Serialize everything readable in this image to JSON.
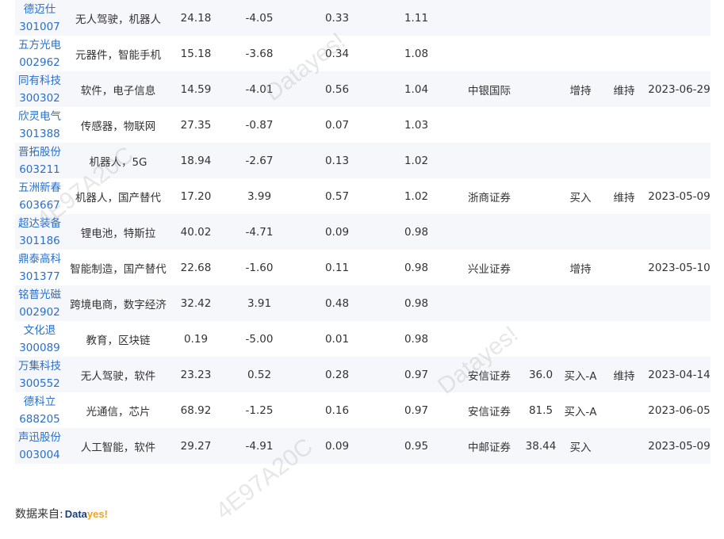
{
  "rows": [
    {
      "name": "德迈仕",
      "code": "301007",
      "concept": "无人驾驶，机器人",
      "price": "24.18",
      "change": "-4.05",
      "v1": "0.33",
      "v2": "1.11",
      "broker": "",
      "target": "",
      "rating": "",
      "rating_change": "",
      "date": ""
    },
    {
      "name": "五方光电",
      "code": "002962",
      "concept": "元器件，智能手机",
      "price": "15.18",
      "change": "-3.68",
      "v1": "0.34",
      "v2": "1.08",
      "broker": "",
      "target": "",
      "rating": "",
      "rating_change": "",
      "date": ""
    },
    {
      "name": "同有科技",
      "code": "300302",
      "concept": "软件，电子信息",
      "price": "14.59",
      "change": "-4.01",
      "v1": "0.56",
      "v2": "1.04",
      "broker": "中银国际",
      "target": "",
      "rating": "增持",
      "rating_change": "维持",
      "date": "2023-06-29"
    },
    {
      "name": "欣灵电气",
      "code": "301388",
      "concept": "传感器，物联网",
      "price": "27.35",
      "change": "-0.87",
      "v1": "0.07",
      "v2": "1.03",
      "broker": "",
      "target": "",
      "rating": "",
      "rating_change": "",
      "date": ""
    },
    {
      "name": "晋拓股份",
      "code": "603211",
      "concept": "机器人，5G",
      "price": "18.94",
      "change": "-2.67",
      "v1": "0.13",
      "v2": "1.02",
      "broker": "",
      "target": "",
      "rating": "",
      "rating_change": "",
      "date": ""
    },
    {
      "name": "五洲新春",
      "code": "603667",
      "concept": "机器人，国产替代",
      "price": "17.20",
      "change": "3.99",
      "v1": "0.57",
      "v2": "1.02",
      "broker": "浙商证券",
      "target": "",
      "rating": "买入",
      "rating_change": "维持",
      "date": "2023-05-09"
    },
    {
      "name": "超达装备",
      "code": "301186",
      "concept": "锂电池，特斯拉",
      "price": "40.02",
      "change": "-4.71",
      "v1": "0.09",
      "v2": "0.98",
      "broker": "",
      "target": "",
      "rating": "",
      "rating_change": "",
      "date": ""
    },
    {
      "name": "鼎泰高科",
      "code": "301377",
      "concept": "智能制造，国产替代",
      "price": "22.68",
      "change": "-1.60",
      "v1": "0.11",
      "v2": "0.98",
      "broker": "兴业证券",
      "target": "",
      "rating": "增持",
      "rating_change": "",
      "date": "2023-05-10"
    },
    {
      "name": "铭普光磁",
      "code": "002902",
      "concept": "跨境电商，数字经济",
      "price": "32.42",
      "change": "3.91",
      "v1": "0.48",
      "v2": "0.98",
      "broker": "",
      "target": "",
      "rating": "",
      "rating_change": "",
      "date": ""
    },
    {
      "name": "文化退",
      "code": "300089",
      "concept": "教育，区块链",
      "price": "0.19",
      "change": "-5.00",
      "v1": "0.01",
      "v2": "0.98",
      "broker": "",
      "target": "",
      "rating": "",
      "rating_change": "",
      "date": ""
    },
    {
      "name": "万集科技",
      "code": "300552",
      "concept": "无人驾驶，软件",
      "price": "23.23",
      "change": "0.52",
      "v1": "0.28",
      "v2": "0.97",
      "broker": "安信证券",
      "target": "36.0",
      "rating": "买入-A",
      "rating_change": "维持",
      "date": "2023-04-14"
    },
    {
      "name": "德科立",
      "code": "688205",
      "concept": "光通信，芯片",
      "price": "68.92",
      "change": "-1.25",
      "v1": "0.16",
      "v2": "0.97",
      "broker": "安信证券",
      "target": "81.5",
      "rating": "买入-A",
      "rating_change": "",
      "date": "2023-06-05"
    },
    {
      "name": "声迅股份",
      "code": "003004",
      "concept": "人工智能，软件",
      "price": "29.27",
      "change": "-4.91",
      "v1": "0.09",
      "v2": "0.95",
      "broker": "中邮证券",
      "target": "38.44",
      "rating": "买入",
      "rating_change": "",
      "date": "2023-05-09"
    }
  ],
  "footer": {
    "source_label": "数据来自:",
    "logo_part1": "Data",
    "logo_part2": "yes!"
  },
  "watermarks": {
    "brand": "Datayes!",
    "code": "4E97A20C"
  },
  "colors": {
    "link": "#2a6fc9",
    "row_stripe": "#f6f7fb",
    "logo_dark": "#1a3f7a",
    "logo_accent": "#f2a31b"
  }
}
